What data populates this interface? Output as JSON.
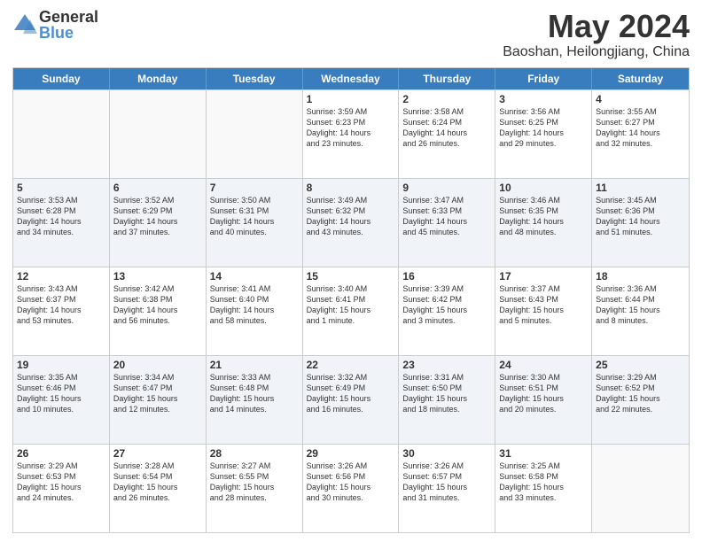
{
  "logo": {
    "general": "General",
    "blue": "Blue"
  },
  "title": {
    "month": "May 2024",
    "location": "Baoshan, Heilongjiang, China"
  },
  "days_of_week": [
    "Sunday",
    "Monday",
    "Tuesday",
    "Wednesday",
    "Thursday",
    "Friday",
    "Saturday"
  ],
  "weeks": [
    [
      {
        "day": "",
        "info": ""
      },
      {
        "day": "",
        "info": ""
      },
      {
        "day": "",
        "info": ""
      },
      {
        "day": "1",
        "info": "Sunrise: 3:59 AM\nSunset: 6:23 PM\nDaylight: 14 hours\nand 23 minutes."
      },
      {
        "day": "2",
        "info": "Sunrise: 3:58 AM\nSunset: 6:24 PM\nDaylight: 14 hours\nand 26 minutes."
      },
      {
        "day": "3",
        "info": "Sunrise: 3:56 AM\nSunset: 6:25 PM\nDaylight: 14 hours\nand 29 minutes."
      },
      {
        "day": "4",
        "info": "Sunrise: 3:55 AM\nSunset: 6:27 PM\nDaylight: 14 hours\nand 32 minutes."
      }
    ],
    [
      {
        "day": "5",
        "info": "Sunrise: 3:53 AM\nSunset: 6:28 PM\nDaylight: 14 hours\nand 34 minutes."
      },
      {
        "day": "6",
        "info": "Sunrise: 3:52 AM\nSunset: 6:29 PM\nDaylight: 14 hours\nand 37 minutes."
      },
      {
        "day": "7",
        "info": "Sunrise: 3:50 AM\nSunset: 6:31 PM\nDaylight: 14 hours\nand 40 minutes."
      },
      {
        "day": "8",
        "info": "Sunrise: 3:49 AM\nSunset: 6:32 PM\nDaylight: 14 hours\nand 43 minutes."
      },
      {
        "day": "9",
        "info": "Sunrise: 3:47 AM\nSunset: 6:33 PM\nDaylight: 14 hours\nand 45 minutes."
      },
      {
        "day": "10",
        "info": "Sunrise: 3:46 AM\nSunset: 6:35 PM\nDaylight: 14 hours\nand 48 minutes."
      },
      {
        "day": "11",
        "info": "Sunrise: 3:45 AM\nSunset: 6:36 PM\nDaylight: 14 hours\nand 51 minutes."
      }
    ],
    [
      {
        "day": "12",
        "info": "Sunrise: 3:43 AM\nSunset: 6:37 PM\nDaylight: 14 hours\nand 53 minutes."
      },
      {
        "day": "13",
        "info": "Sunrise: 3:42 AM\nSunset: 6:38 PM\nDaylight: 14 hours\nand 56 minutes."
      },
      {
        "day": "14",
        "info": "Sunrise: 3:41 AM\nSunset: 6:40 PM\nDaylight: 14 hours\nand 58 minutes."
      },
      {
        "day": "15",
        "info": "Sunrise: 3:40 AM\nSunset: 6:41 PM\nDaylight: 15 hours\nand 1 minute."
      },
      {
        "day": "16",
        "info": "Sunrise: 3:39 AM\nSunset: 6:42 PM\nDaylight: 15 hours\nand 3 minutes."
      },
      {
        "day": "17",
        "info": "Sunrise: 3:37 AM\nSunset: 6:43 PM\nDaylight: 15 hours\nand 5 minutes."
      },
      {
        "day": "18",
        "info": "Sunrise: 3:36 AM\nSunset: 6:44 PM\nDaylight: 15 hours\nand 8 minutes."
      }
    ],
    [
      {
        "day": "19",
        "info": "Sunrise: 3:35 AM\nSunset: 6:46 PM\nDaylight: 15 hours\nand 10 minutes."
      },
      {
        "day": "20",
        "info": "Sunrise: 3:34 AM\nSunset: 6:47 PM\nDaylight: 15 hours\nand 12 minutes."
      },
      {
        "day": "21",
        "info": "Sunrise: 3:33 AM\nSunset: 6:48 PM\nDaylight: 15 hours\nand 14 minutes."
      },
      {
        "day": "22",
        "info": "Sunrise: 3:32 AM\nSunset: 6:49 PM\nDaylight: 15 hours\nand 16 minutes."
      },
      {
        "day": "23",
        "info": "Sunrise: 3:31 AM\nSunset: 6:50 PM\nDaylight: 15 hours\nand 18 minutes."
      },
      {
        "day": "24",
        "info": "Sunrise: 3:30 AM\nSunset: 6:51 PM\nDaylight: 15 hours\nand 20 minutes."
      },
      {
        "day": "25",
        "info": "Sunrise: 3:29 AM\nSunset: 6:52 PM\nDaylight: 15 hours\nand 22 minutes."
      }
    ],
    [
      {
        "day": "26",
        "info": "Sunrise: 3:29 AM\nSunset: 6:53 PM\nDaylight: 15 hours\nand 24 minutes."
      },
      {
        "day": "27",
        "info": "Sunrise: 3:28 AM\nSunset: 6:54 PM\nDaylight: 15 hours\nand 26 minutes."
      },
      {
        "day": "28",
        "info": "Sunrise: 3:27 AM\nSunset: 6:55 PM\nDaylight: 15 hours\nand 28 minutes."
      },
      {
        "day": "29",
        "info": "Sunrise: 3:26 AM\nSunset: 6:56 PM\nDaylight: 15 hours\nand 30 minutes."
      },
      {
        "day": "30",
        "info": "Sunrise: 3:26 AM\nSunset: 6:57 PM\nDaylight: 15 hours\nand 31 minutes."
      },
      {
        "day": "31",
        "info": "Sunrise: 3:25 AM\nSunset: 6:58 PM\nDaylight: 15 hours\nand 33 minutes."
      },
      {
        "day": "",
        "info": ""
      }
    ]
  ]
}
